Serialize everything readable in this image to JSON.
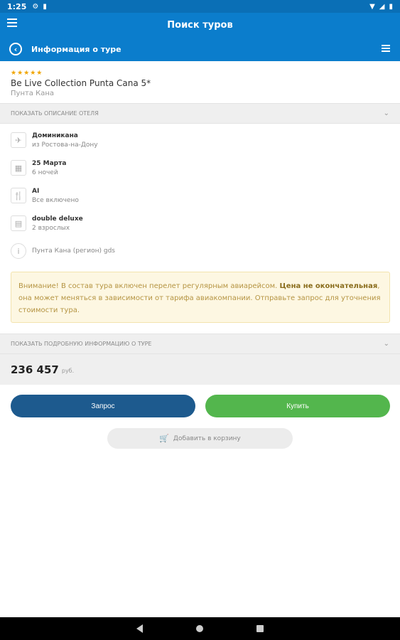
{
  "status_bar": {
    "time": "1:25"
  },
  "app_bar": {
    "title": "Поиск туров"
  },
  "sub_bar": {
    "title": "Информация о туре"
  },
  "hotel": {
    "stars": "★★★★★",
    "name": "Be Live Collection Punta Cana 5*",
    "city": "Пунта Кана"
  },
  "sections": {
    "hotel_description": "ПОКАЗАТЬ ОПИСАНИЕ ОТЕЛЯ",
    "tour_details": "ПОКАЗАТЬ ПОДРОБНУЮ ИНФОРМАЦИЮ О ТУРЕ"
  },
  "details": [
    {
      "icon": "plane-icon",
      "main": "Доминикана",
      "sub": "из Ростова-на-Дону"
    },
    {
      "icon": "calendar-icon",
      "main": "25 Марта",
      "sub": "6 ночей"
    },
    {
      "icon": "fork-knife-icon",
      "main": "AI",
      "sub": "Все включено"
    },
    {
      "icon": "bed-icon",
      "main": "double deluxe",
      "sub": "2 взрослых"
    }
  ],
  "region": "Пунта Кана (регион) gds",
  "notice": {
    "part1": "Внимание! В состав тура включен перелет регулярным авиарейсом. ",
    "bold": "Цена не окончательная",
    "part2": ", она может меняться в зависимости от тарифа авиакомпании. Отправьте запрос для уточнения стоимости тура."
  },
  "price": {
    "value": "236 457",
    "currency": "руб."
  },
  "buttons": {
    "request": "Запрос",
    "buy": "Купить",
    "add_to_cart": "Добавить в корзину"
  }
}
